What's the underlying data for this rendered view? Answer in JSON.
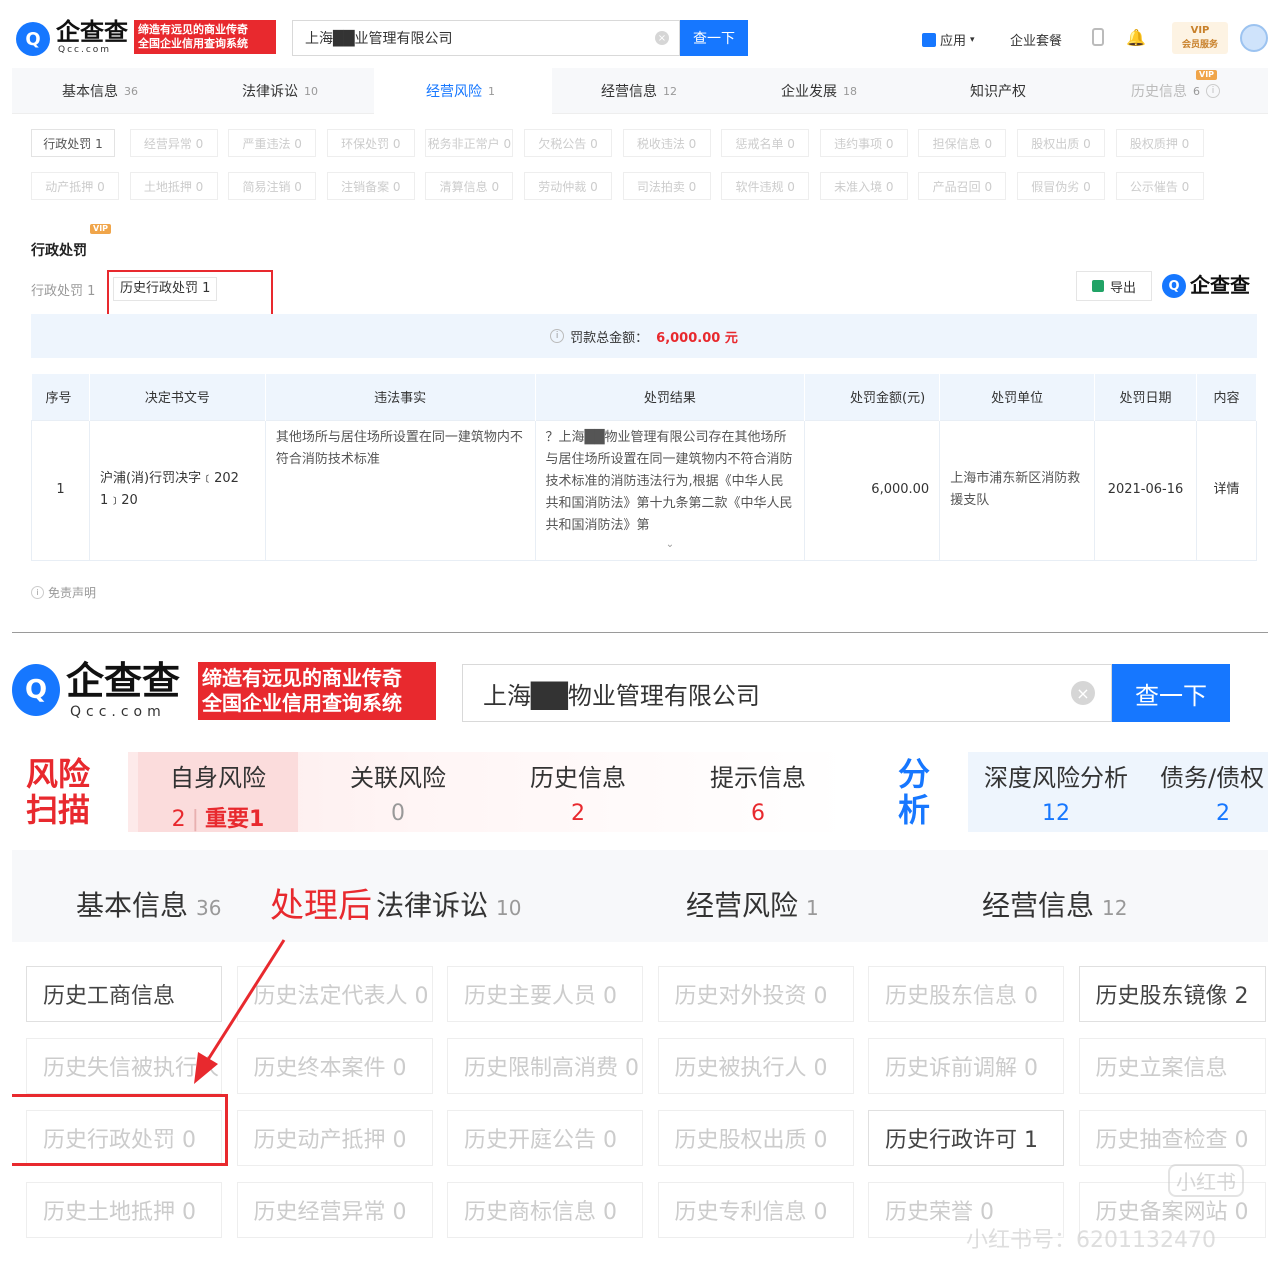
{
  "top": {
    "logo": {
      "text": "企查查",
      "sub": "Qcc.com",
      "slogan_line1": "缔造有远见的商业传奇",
      "slogan_line2": "全国企业信用查询系统"
    },
    "search": {
      "value": "上海██业管理有限公司",
      "button": "查一下"
    },
    "header_links": {
      "apps": "应用",
      "enterprise": "企业套餐",
      "vip": "VIP",
      "vip_sub": "会员服务"
    },
    "tabs": [
      {
        "label": "基本信息",
        "count": "36"
      },
      {
        "label": "法律诉讼",
        "count": "10"
      },
      {
        "label": "经营风险",
        "count": "1"
      },
      {
        "label": "经营信息",
        "count": "12"
      },
      {
        "label": "企业发展",
        "count": "18"
      },
      {
        "label": "知识产权",
        "count": ""
      },
      {
        "label": "历史信息",
        "count": "6"
      }
    ],
    "risk_chips_row1": [
      "行政处罚 1",
      "经营异常 0",
      "严重违法 0",
      "环保处罚 0",
      "税务非正常户 0",
      "欠税公告 0",
      "税收违法 0",
      "惩戒名单 0",
      "违约事项 0",
      "担保信息 0",
      "股权出质 0",
      "股权质押 0"
    ],
    "risk_chips_row2": [
      "动产抵押 0",
      "土地抵押 0",
      "简易注销 0",
      "注销备案 0",
      "清算信息 0",
      "劳动仲裁 0",
      "司法拍卖 0",
      "软件违规 0",
      "未准入境 0",
      "产品召回 0",
      "假冒伪劣 0",
      "公示催告 0"
    ],
    "section": {
      "vip": "VIP",
      "title": "行政处罚",
      "sub_tab1": "行政处罚 1",
      "sub_tab2": "历史行政处罚 1",
      "export": "导出",
      "brand": "企查查",
      "sum_label": "罚款总金额：",
      "sum_value": "6,000.00 元"
    },
    "table": {
      "headers": [
        "序号",
        "决定书文号",
        "违法事实",
        "处罚结果",
        "处罚金额(元)",
        "处罚单位",
        "处罚日期",
        "内容"
      ],
      "rows": [
        {
          "no": "1",
          "doc": "沪浦(消)行罚决字﹝202 1﹞20",
          "fact": "其他场所与居住场所设置在同一建筑物内不符合消防技术标准",
          "result": "？上海██物业管理有限公司存在其他场所与居住场所设置在同一建筑物内不符合消防技术标准的消防违法行为,根据《中华人民共和国消防法》第十九条第二款《中华人民共和国消防法》第",
          "amount": "6,000.00",
          "unit": "上海市浦东新区消防救援支队",
          "date": "2021-06-16",
          "detail": "详情"
        }
      ]
    },
    "disclaimer": "免责声明"
  },
  "bottom": {
    "logo": {
      "text": "企查查",
      "sub": "Qcc.com",
      "slogan_line1": "缔造有远见的商业传奇",
      "slogan_line2": "全国企业信用查询系统"
    },
    "search": {
      "value": "上海██物业管理有限公司",
      "button": "查一下"
    },
    "risk_scan": {
      "title_line1": "风险",
      "title_line2": "扫描",
      "items": [
        {
          "label": "自身风险",
          "value": "2",
          "extra": "重要1"
        },
        {
          "label": "关联风险",
          "value": "0"
        },
        {
          "label": "历史信息",
          "value": "2"
        },
        {
          "label": "提示信息",
          "value": "6"
        }
      ],
      "analysis_line1": "分",
      "analysis_line2": "析",
      "analysis_items": [
        {
          "label": "深度风险分析",
          "value": "12"
        },
        {
          "label": "债务/债权",
          "value": "2"
        }
      ]
    },
    "tabs": [
      {
        "label": "基本信息",
        "count": "36"
      },
      {
        "label": "法律诉讼",
        "count": "10"
      },
      {
        "label": "经营风险",
        "count": "1"
      },
      {
        "label": "经营信息",
        "count": "12"
      }
    ],
    "annotation": "处理后",
    "history_chips": [
      [
        "历史工商信息",
        "历史法定代表人 0",
        "历史主要人员 0",
        "历史对外投资 0",
        "历史股东信息 0",
        "历史股东镜像 2"
      ],
      [
        "历史失信被执行人 0",
        "历史终本案件 0",
        "历史限制高消费 0",
        "历史被执行人 0",
        "历史诉前调解 0",
        "历史立案信息"
      ],
      [
        "历史行政处罚 0",
        "历史动产抵押 0",
        "历史开庭公告 0",
        "历史股权出质 0",
        "历史行政许可 1",
        "历史抽查检查 0"
      ],
      [
        "历史土地抵押 0",
        "历史经营异常 0",
        "历史商标信息 0",
        "历史专利信息 0",
        "历史荣誉 0",
        "历史备案网站 0"
      ]
    ],
    "watermark": "小红书号：6201132470",
    "watermark_logo": "小红书"
  },
  "colors": {
    "brand_blue": "#1677ff",
    "brand_red": "#e8292e",
    "vip_orange": "#f0a54a"
  }
}
